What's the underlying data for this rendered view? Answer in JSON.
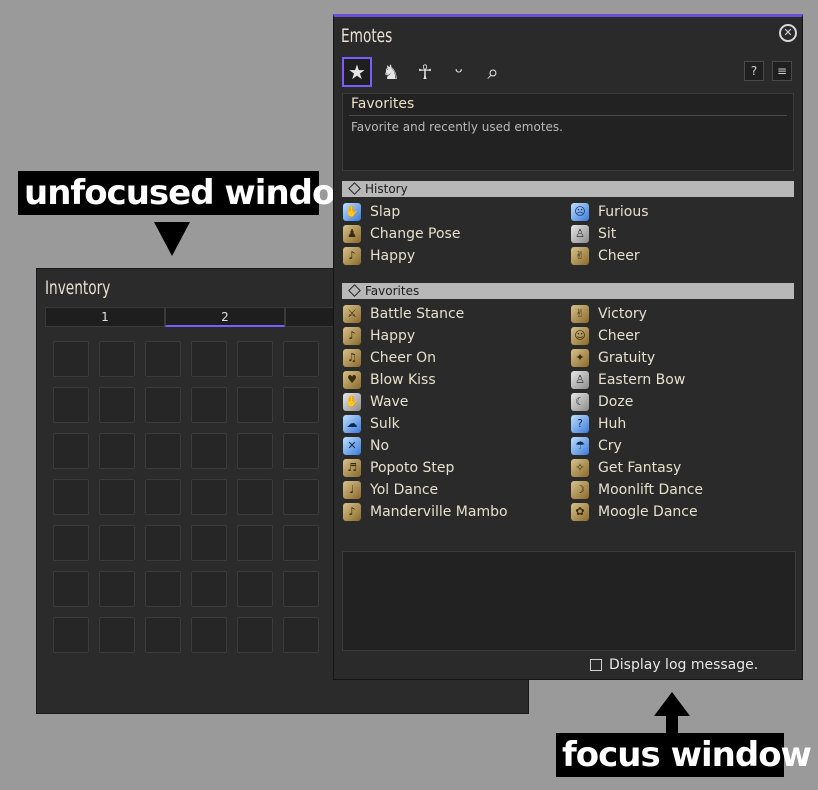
{
  "annotations": {
    "unfocused_label": "unfocused window",
    "focus_label": "focus window"
  },
  "inventory": {
    "title": "Inventory",
    "tabs": [
      "1",
      "2"
    ],
    "active_tab": "2"
  },
  "emotes": {
    "title": "Emotes",
    "close_icon": "close-icon",
    "tab_icons": [
      "star-icon",
      "person-icon",
      "dance-icon",
      "smile-icon",
      "search-icon"
    ],
    "selected_tab": "star-icon",
    "help_icon": "question-icon",
    "sort_icon": "sort-icon",
    "description": {
      "title": "Favorites",
      "text": "Favorite and recently used emotes."
    },
    "history": {
      "label": "History",
      "items": [
        "Slap",
        "Furious",
        "Change Pose",
        "Sit",
        "Happy",
        "Cheer"
      ]
    },
    "favorites": {
      "label": "Favorites",
      "items": [
        "Battle Stance",
        "Victory",
        "Happy",
        "Cheer",
        "Cheer On",
        "Gratuity",
        "Blow Kiss",
        "Eastern Bow",
        "Wave",
        "Doze",
        "Sulk",
        "Huh",
        "No",
        "Cry",
        "Popoto Step",
        "Get Fantasy",
        "Yol Dance",
        "Moonlift Dance",
        "Manderville Mambo",
        "Moogle Dance"
      ]
    },
    "log_option": {
      "label": "Display log message.",
      "checked": false
    }
  },
  "colors": {
    "accent": "#7a5cff",
    "background": "#9a9a9a",
    "window": "#2a2a2a"
  }
}
